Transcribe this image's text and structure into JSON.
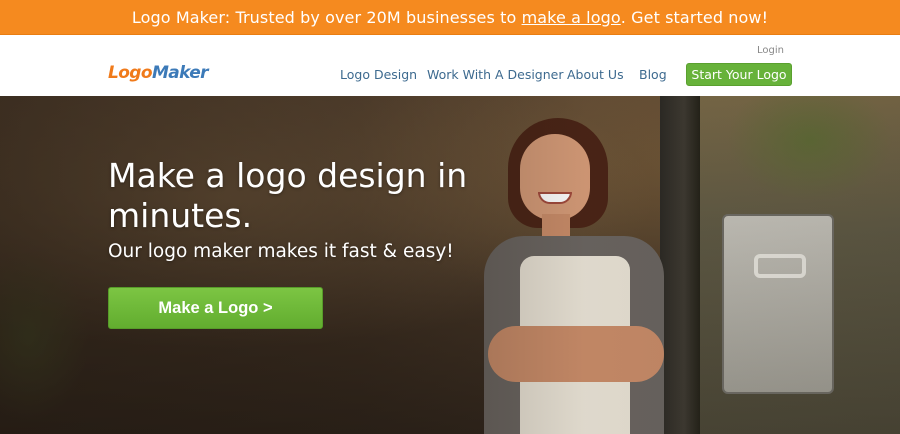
{
  "promo": {
    "prefix": "Logo Maker: Trusted by over 20M businesses to ",
    "link": "make a logo",
    "suffix": ". Get started now!"
  },
  "header": {
    "logo_part1": "Logo",
    "logo_part2": "Maker",
    "login": "Login",
    "nav": [
      "Logo Design",
      "Work With A Designer",
      "About Us",
      "Blog"
    ],
    "cta": "Start Your Logo"
  },
  "hero": {
    "title": "Make a logo design in minutes.",
    "subtitle": "Our logo maker makes it fast & easy!",
    "cta": "Make a Logo >"
  },
  "colors": {
    "promo_bg": "#f58a1f",
    "logo_orange": "#f07a1a",
    "logo_blue": "#3c7ab8",
    "nav_text": "#3d6a8f",
    "cta_green": "#67b23a"
  }
}
